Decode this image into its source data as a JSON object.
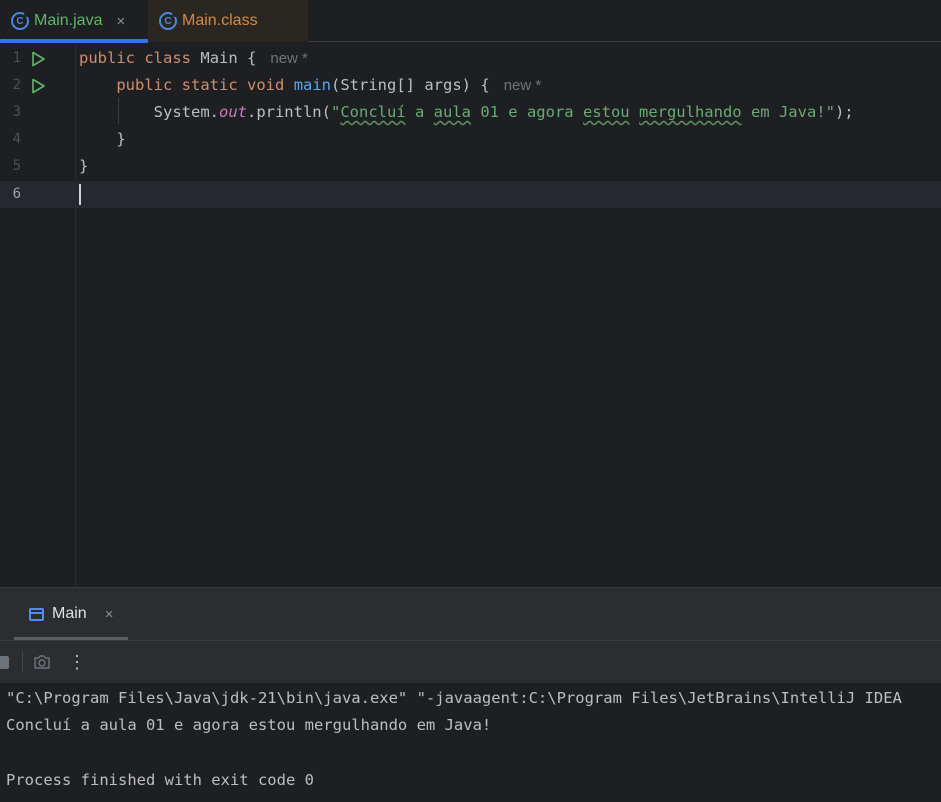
{
  "tabs": [
    {
      "label": "Main.java",
      "active": true,
      "icon": "java-class-icon",
      "close": "×"
    },
    {
      "label": "Main.class",
      "active": false,
      "icon": "java-class-icon"
    }
  ],
  "editor": {
    "line_numbers": [
      "1",
      "2",
      "3",
      "4",
      "5",
      "6"
    ],
    "line1": {
      "kw1": "public",
      "kw2": "class",
      "name": "Main",
      "brace": "{",
      "hint": "new *"
    },
    "line2": {
      "kw1": "public",
      "kw2": "static",
      "kw3": "void",
      "method": "main",
      "params": "(String[] args)",
      "brace": "{",
      "hint": "new *"
    },
    "line3": {
      "obj": "System.",
      "field": "out",
      "call": ".println(",
      "str_parts": [
        "\"",
        "Concluí",
        " a ",
        "aula",
        " 01 e agora ",
        "estou",
        " ",
        "mergulhando",
        " em Java!\""
      ],
      "end": ");"
    },
    "line4": {
      "brace": "}"
    },
    "line5": {
      "brace": "}"
    }
  },
  "run_panel": {
    "tab_label": "Main",
    "tab_close": "×",
    "toolbar_more": "⋮",
    "console_lines": [
      "\"C:\\Program Files\\Java\\jdk-21\\bin\\java.exe\" \"-javaagent:C:\\Program Files\\JetBrains\\IntelliJ IDEA",
      "Concluí a aula 01 e agora estou mergulhando em Java!",
      "",
      "Process finished with exit code 0"
    ]
  },
  "colors": {
    "background": "#1e1f22",
    "keyword": "#cf8e6d",
    "string": "#6aab73",
    "method": "#56a8f5",
    "field": "#c77dbb",
    "accent": "#3574f0"
  }
}
